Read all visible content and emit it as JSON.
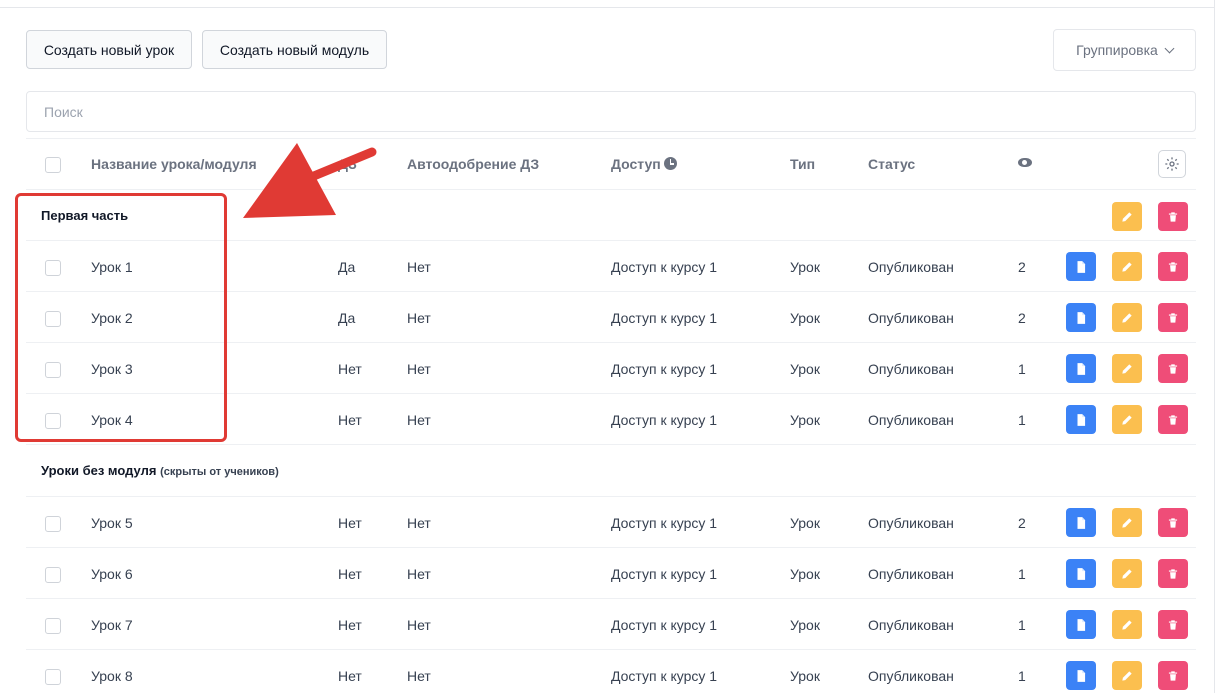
{
  "toolbar": {
    "create_lesson_label": "Создать новый урок",
    "create_module_label": "Создать новый модуль",
    "grouping_label": "Группировка"
  },
  "search": {
    "placeholder": "Поиск"
  },
  "table": {
    "headers": {
      "name": "Название урока/модуля",
      "dz": "ДЗ",
      "auto_approve": "Автоодобрение ДЗ",
      "access": "Доступ",
      "type": "Тип",
      "status": "Статус"
    },
    "icons": {
      "access_hint": "clock-icon",
      "views": "eye-icon",
      "settings": "gear-icon"
    },
    "groups": [
      {
        "title": "Первая часть",
        "note": "",
        "rows": [
          {
            "name": "Урок 1",
            "dz": "Да",
            "auto": "Нет",
            "access": "Доступ к курсу 1",
            "type": "Урок",
            "status": "Опубликован",
            "views": "2"
          },
          {
            "name": "Урок 2",
            "dz": "Да",
            "auto": "Нет",
            "access": "Доступ к курсу 1",
            "type": "Урок",
            "status": "Опубликован",
            "views": "2"
          },
          {
            "name": "Урок 3",
            "dz": "Нет",
            "auto": "Нет",
            "access": "Доступ к курсу 1",
            "type": "Урок",
            "status": "Опубликован",
            "views": "1"
          },
          {
            "name": "Урок 4",
            "dz": "Нет",
            "auto": "Нет",
            "access": "Доступ к курсу 1",
            "type": "Урок",
            "status": "Опубликован",
            "views": "1"
          }
        ]
      },
      {
        "title": "Уроки без модуля",
        "note": "(скрыты от учеников)",
        "rows": [
          {
            "name": "Урок 5",
            "dz": "Нет",
            "auto": "Нет",
            "access": "Доступ к курсу 1",
            "type": "Урок",
            "status": "Опубликован",
            "views": "2"
          },
          {
            "name": "Урок 6",
            "dz": "Нет",
            "auto": "Нет",
            "access": "Доступ к курсу 1",
            "type": "Урок",
            "status": "Опубликован",
            "views": "1"
          },
          {
            "name": "Урок 7",
            "dz": "Нет",
            "auto": "Нет",
            "access": "Доступ к курсу 1",
            "type": "Урок",
            "status": "Опубликован",
            "views": "1"
          },
          {
            "name": "Урок 8",
            "dz": "Нет",
            "auto": "Нет",
            "access": "Доступ к курсу 1",
            "type": "Урок",
            "status": "Опубликован",
            "views": "1"
          }
        ]
      }
    ]
  },
  "colors": {
    "view_button": "#3b82f6",
    "edit_button": "#fbbf4f",
    "delete_button": "#ef4d78",
    "annotation": "#e03a34"
  }
}
